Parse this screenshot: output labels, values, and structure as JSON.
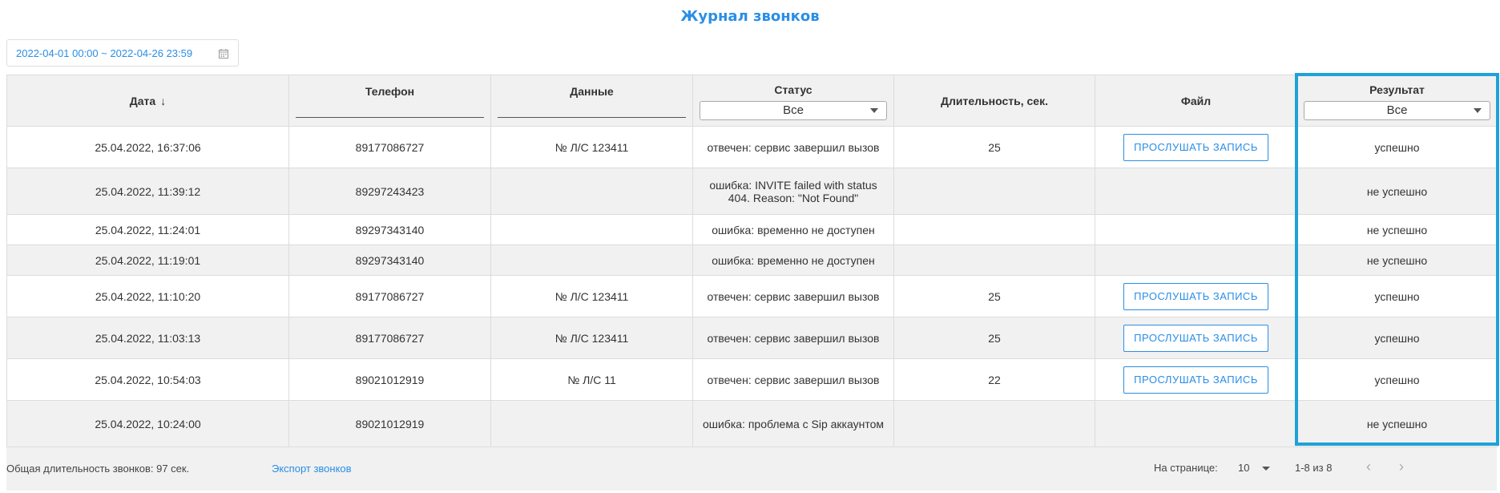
{
  "title": "Журнал звонков",
  "date_range": "2022-04-01 00:00 ~ 2022-04-26 23:59",
  "icons": {
    "calendar": "calendar-icon",
    "sort": "arrow-down-icon",
    "caret": "caret-down-icon",
    "prev": "chevron-left-icon",
    "next": "chevron-right-icon"
  },
  "columns": {
    "date": "Дата",
    "sort_arrow": "↓",
    "phone": "Телефон",
    "data": "Данные",
    "status": "Статус",
    "status_filter": "Все",
    "duration": "Длительность, сек.",
    "file": "Файл",
    "result": "Результат",
    "result_filter": "Все"
  },
  "listen_label": "ПРОСЛУШАТЬ ЗАПИСЬ",
  "rows": [
    {
      "date": "25.04.2022, 16:37:06",
      "phone": "89177086727",
      "data": "№ Л/С 123411",
      "status": "отвечен: сервис завершил вызов",
      "duration": "25",
      "has_file": true,
      "result": "успешно"
    },
    {
      "date": "25.04.2022, 11:39:12",
      "phone": "89297243423",
      "data": "",
      "status": "ошибка: INVITE failed with status 404. Reason: \"Not Found\"",
      "duration": "",
      "has_file": false,
      "result": "не успешно"
    },
    {
      "date": "25.04.2022, 11:24:01",
      "phone": "89297343140",
      "data": "",
      "status": "ошибка: временно не доступен",
      "duration": "",
      "has_file": false,
      "result": "не успешно"
    },
    {
      "date": "25.04.2022, 11:19:01",
      "phone": "89297343140",
      "data": "",
      "status": "ошибка: временно не доступен",
      "duration": "",
      "has_file": false,
      "result": "не успешно"
    },
    {
      "date": "25.04.2022, 11:10:20",
      "phone": "89177086727",
      "data": "№ Л/С 123411",
      "status": "отвечен: сервис завершил вызов",
      "duration": "25",
      "has_file": true,
      "result": "успешно"
    },
    {
      "date": "25.04.2022, 11:03:13",
      "phone": "89177086727",
      "data": "№ Л/С 123411",
      "status": "отвечен: сервис завершил вызов",
      "duration": "25",
      "has_file": true,
      "result": "успешно"
    },
    {
      "date": "25.04.2022, 10:54:03",
      "phone": "89021012919",
      "data": "№ Л/С 11",
      "status": "отвечен: сервис завершил вызов",
      "duration": "22",
      "has_file": true,
      "result": "успешно"
    },
    {
      "date": "25.04.2022, 10:24:00",
      "phone": "89021012919",
      "data": "",
      "status": "ошибка: проблема с Sip аккаунтом",
      "duration": "",
      "has_file": false,
      "result": "не успешно"
    }
  ],
  "footer": {
    "total": "Общая длительность звонков: 97 сек.",
    "export": "Экспорт звонков",
    "per_page_label": "На странице:",
    "per_page_value": "10",
    "range": "1-8 из 8",
    "prev": "‹",
    "next": "›"
  },
  "colors": {
    "accent": "#2a8ee6",
    "highlight": "#1ea2d8"
  }
}
